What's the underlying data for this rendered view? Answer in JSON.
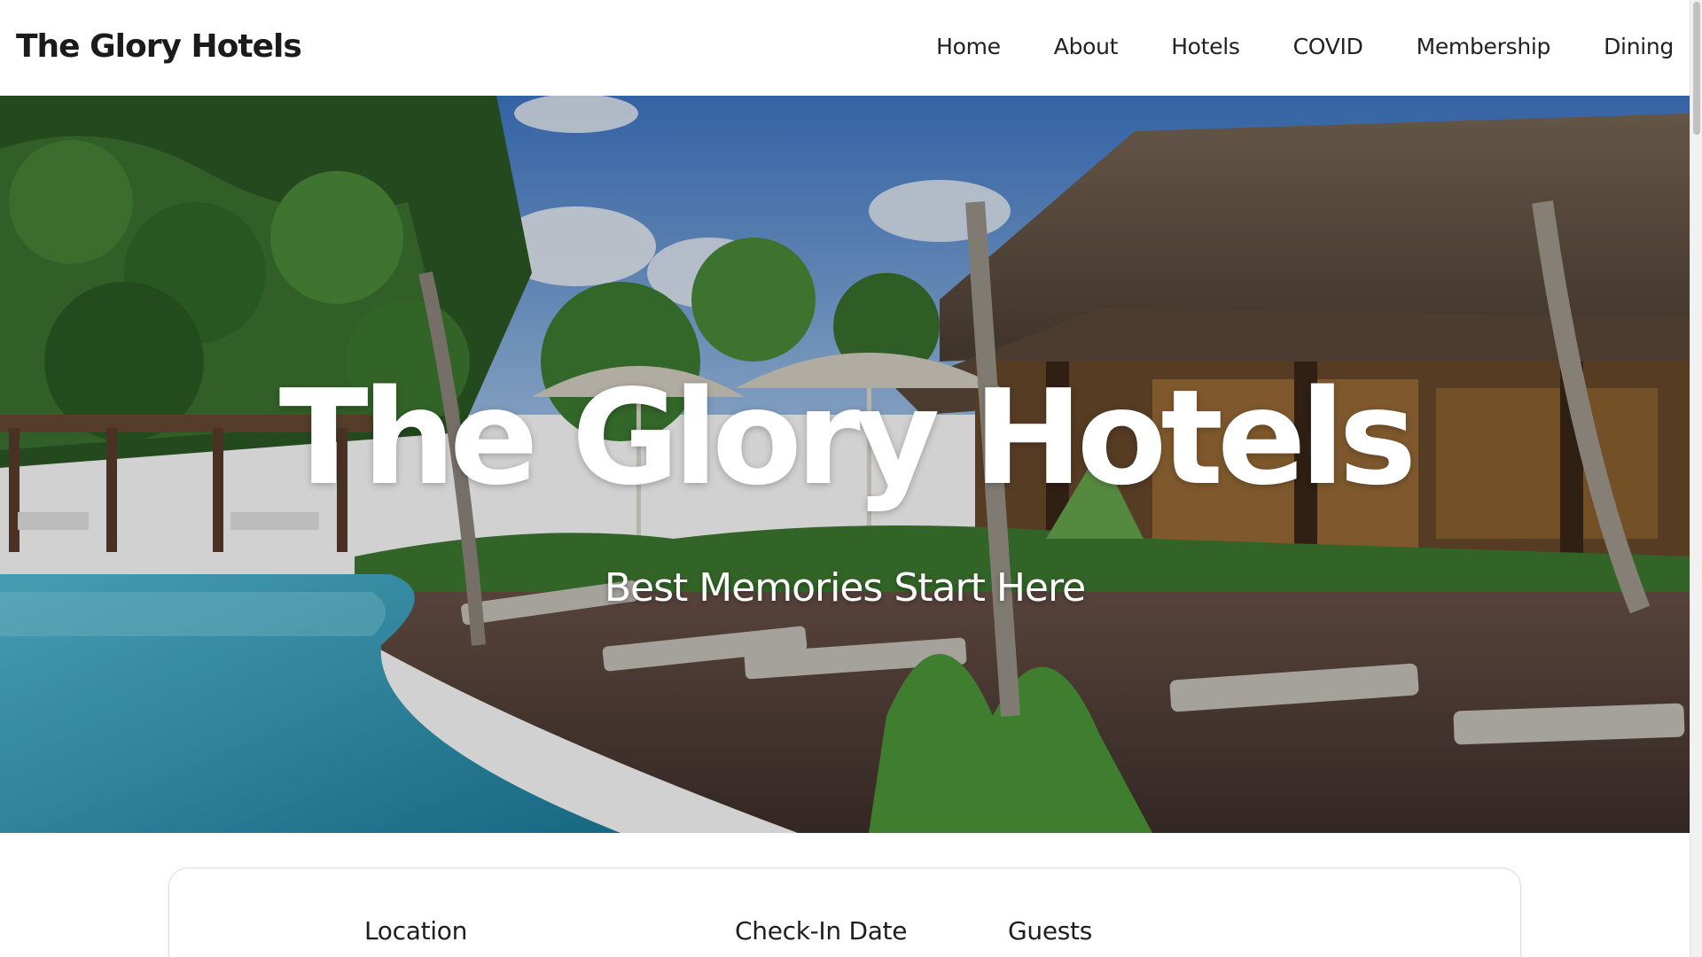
{
  "header": {
    "brand": "The Glory Hotels",
    "nav": [
      "Home",
      "About",
      "Hotels",
      "COVID",
      "Membership",
      "Dining"
    ]
  },
  "hero": {
    "title": "The Glory Hotels",
    "subtitle": "Best Memories Start Here",
    "image": "resort-pool-photo"
  },
  "booking": {
    "location_label": "Location",
    "checkin_label": "Check-In Date",
    "guests_label": "Guests"
  },
  "colors": {
    "text_dark": "#1b1b1b",
    "hero_text": "#ffffff",
    "pool": "#3aa6c7",
    "foliage": "#2f6b2a",
    "sky": "#5b8fd6"
  }
}
